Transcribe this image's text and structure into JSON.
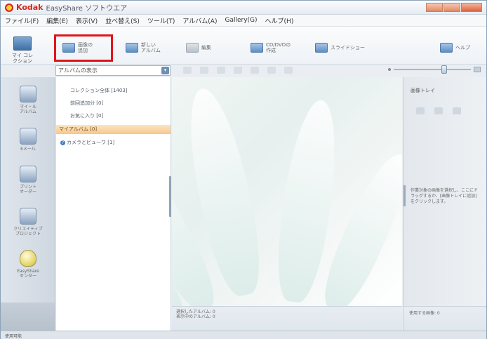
{
  "window": {
    "brand": "Kodak",
    "title": "EasyShare ソフトウエア"
  },
  "menu": [
    "ファイル(F)",
    "編集(E)",
    "表示(V)",
    "並べ替え(S)",
    "ツール(T)",
    "アルバム(A)",
    "Gallery(G)",
    "ヘルプ(H)"
  ],
  "toolbar": {
    "my_collection": "マイ\nコレクション",
    "buttons": [
      {
        "label": "画像の\n追加",
        "icon": "add-pictures-icon"
      },
      {
        "label": "新しい\nアルバム",
        "icon": "new-album-icon"
      },
      {
        "label": "編集",
        "icon": "edit-icon"
      },
      {
        "label": "CD/DVDの\n作成",
        "icon": "cd-dvd-icon"
      },
      {
        "label": "スライドショー",
        "icon": "slideshow-icon"
      },
      {
        "label": "ヘルプ",
        "icon": "help-icon"
      }
    ]
  },
  "filter": {
    "album_view": "アルバムの表示"
  },
  "rail": [
    {
      "label": "マイ・ル\nアルバム",
      "icon": "printer-icon"
    },
    {
      "label": "Eメール",
      "icon": "email-icon"
    },
    {
      "label": "プリント\nオーダー",
      "icon": "print-order-icon"
    },
    {
      "label": "クリエイティブ\nプロジェクト",
      "icon": "creative-projects-icon"
    },
    {
      "label": "EasyShare\nセンター",
      "icon": "lightbulb-icon"
    }
  ],
  "tree": {
    "items": [
      "コレクション全体 [1403]",
      "前回追加分 [0]",
      "お気に入り [0]",
      "マイアルバム [0]",
      "カメラとビューワ [1]"
    ]
  },
  "content_status": {
    "line1": "選択したアルバム: 0",
    "line2": "表示中のアルバム: 0"
  },
  "tray": {
    "title": "画像トレイ",
    "help": "作業対象の画像を選択し、ここにドラッグするか、[画像トレイに追加]をクリックします。",
    "status": "使用する画像:  0"
  },
  "statusbar": {
    "text": "使用可能"
  },
  "colors": {
    "highlight": "#e0151b",
    "brand": "#d7261e",
    "selected_row": "#f6c88c"
  }
}
